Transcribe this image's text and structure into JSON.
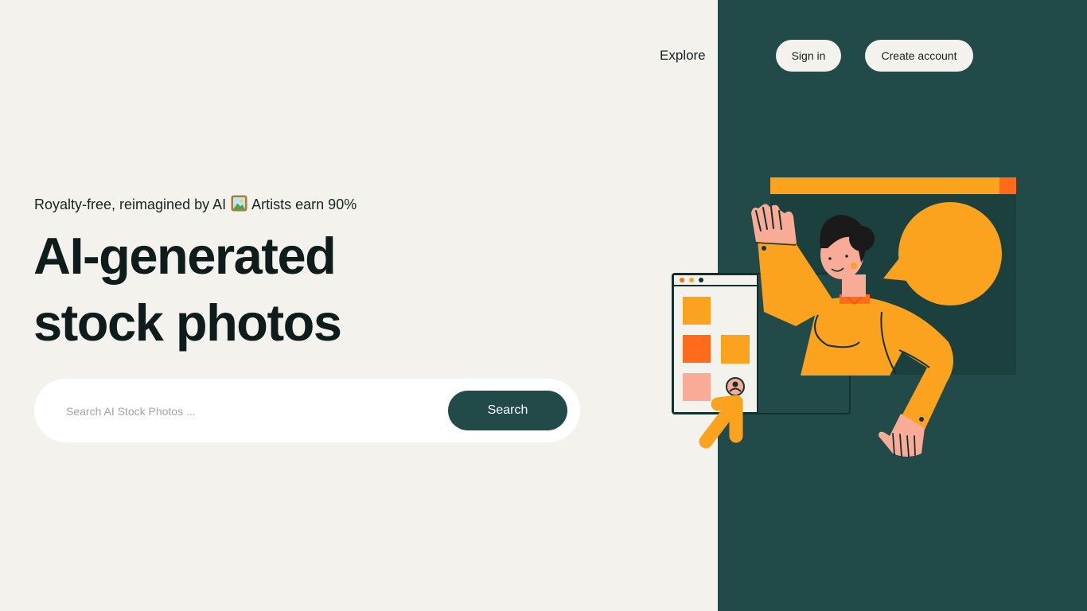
{
  "header": {
    "nav_explore": "Explore",
    "sign_in": "Sign in",
    "create_account": "Create account"
  },
  "hero": {
    "tagline_before": "Royalty-free, reimagined by AI",
    "tagline_icon": "framed-picture-icon",
    "tagline_after": "Artists earn 90%",
    "headline_line1": "AI-generated",
    "headline_line2": "stock photos"
  },
  "search": {
    "placeholder": "Search AI Stock Photos ...",
    "button_label": "Search"
  },
  "illustration": {
    "name": "person-waving-illustration"
  },
  "colors": {
    "background": "#f4f2ed",
    "panel": "#214a48",
    "accent_orange": "#fba21f",
    "accent_red_orange": "#ff6b1a",
    "skin": "#f8ac98",
    "text_dark": "#0e1c1b"
  }
}
